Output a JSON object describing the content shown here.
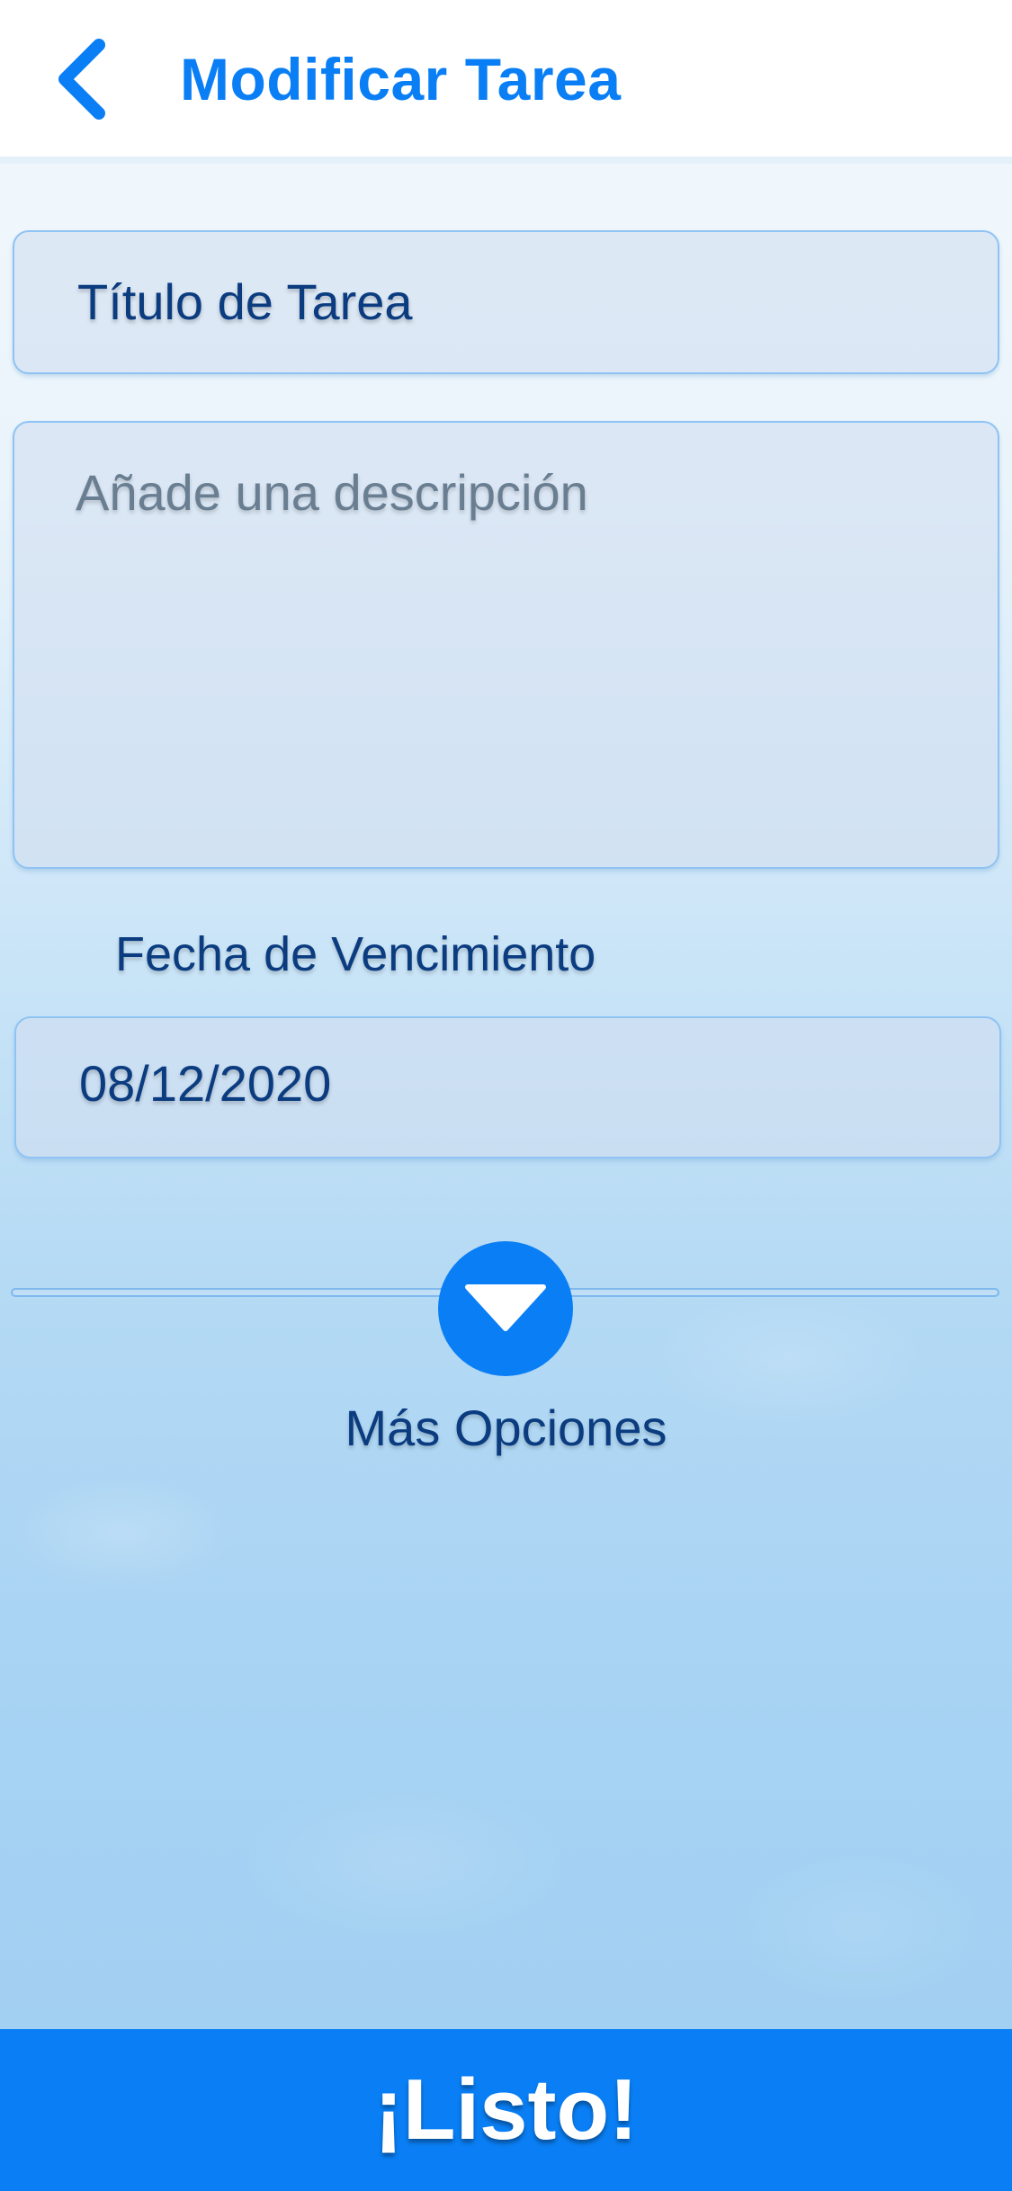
{
  "header": {
    "title": "Modificar Tarea",
    "back_icon": "chevron-left-icon"
  },
  "form": {
    "title_value": "Título de Tarea",
    "description_placeholder": "Añade una descripción",
    "due_date_label": "Fecha de Vencimiento",
    "due_date_value": "08/12/2020"
  },
  "more_options": {
    "icon": "chevron-down-icon",
    "label": "Más Opciones"
  },
  "footer": {
    "done_label": "¡Listo!"
  },
  "colors": {
    "accent": "#0a7ff5",
    "text": "#0b3c80"
  }
}
